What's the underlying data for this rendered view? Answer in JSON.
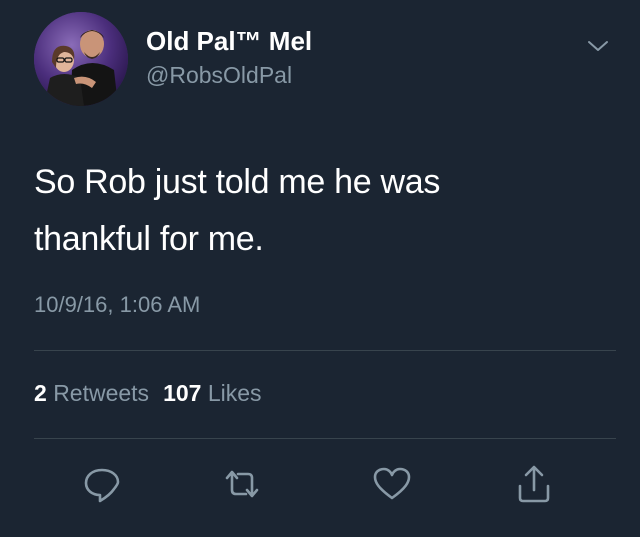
{
  "user": {
    "display_name": "Old Pal™ Mel",
    "handle": "@RobsOldPal",
    "avatar_icon": "profile-photo"
  },
  "tweet": {
    "text_line1": "So Rob just told me he was",
    "text_line2": "thankful for me.",
    "timestamp": "10/9/16, 1:06 AM"
  },
  "stats": {
    "retweets_count": "2",
    "retweets_label": "Retweets",
    "likes_count": "107",
    "likes_label": "Likes"
  },
  "actions": {
    "reply_icon": "reply-icon",
    "retweet_icon": "retweet-icon",
    "like_icon": "heart-icon",
    "share_icon": "share-icon"
  },
  "colors": {
    "background": "#1b2532",
    "primary_text": "#ffffff",
    "secondary_text": "#8899a6",
    "divider": "#38444d"
  }
}
